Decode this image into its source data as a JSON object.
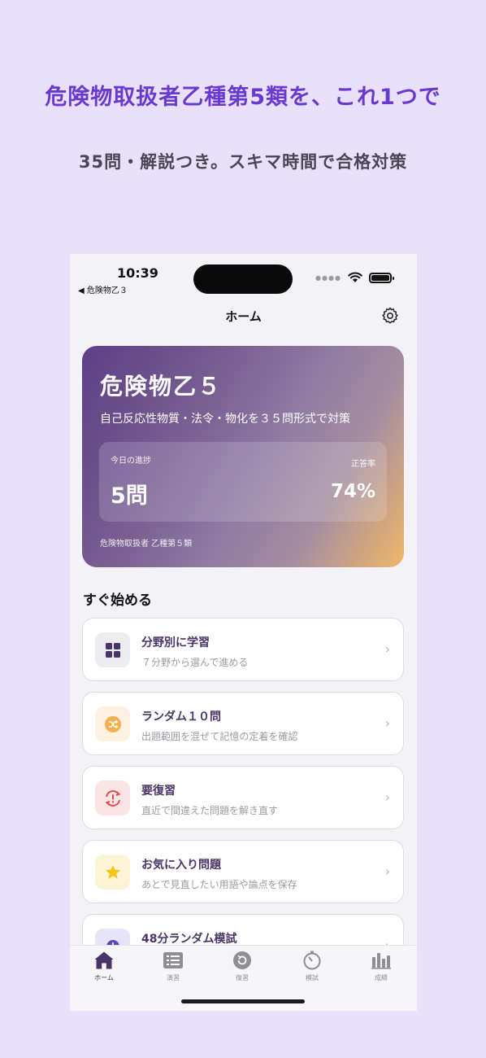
{
  "promo": {
    "title": "危険物取扱者乙種第5類を、これ1つで",
    "subtitle": "35問・解説つき。スキマ時間で合格対策"
  },
  "status_bar": {
    "time": "10:39",
    "back_label": "◀ 危険物乙３"
  },
  "nav": {
    "title": "ホーム"
  },
  "hero": {
    "title": "危険物乙５",
    "subtitle": "自己反応性物質・法令・物化を３５問形式で対策",
    "progress_label": "今日の進捗",
    "progress_value": "5問",
    "accuracy_label": "正答率",
    "accuracy_value": "74%",
    "footer": "危険物取扱者 乙種第５類"
  },
  "quick_start": {
    "section_title": "すぐ始める",
    "items": [
      {
        "title": "分野別に学習",
        "desc": "７分野から選んで進める",
        "icon": "grid-icon"
      },
      {
        "title": "ランダム１０問",
        "desc": "出題範囲を混ぜて記憶の定着を確認",
        "icon": "shuffle-icon"
      },
      {
        "title": "要復習",
        "desc": "直近で間違えた問題を解き直す",
        "icon": "review-alert-icon"
      },
      {
        "title": "お気に入り問題",
        "desc": "あとで見直したい用語や論点を保存",
        "icon": "star-icon"
      },
      {
        "title": "48分ランダム模試",
        "desc": "",
        "icon": "timer-icon"
      }
    ]
  },
  "tabbar": {
    "tabs": [
      {
        "label": "ホーム",
        "icon": "house-icon",
        "active": true
      },
      {
        "label": "演習",
        "icon": "list-icon",
        "active": false
      },
      {
        "label": "復習",
        "icon": "review-icon",
        "active": false
      },
      {
        "label": "模試",
        "icon": "stopwatch-icon",
        "active": false
      },
      {
        "label": "成績",
        "icon": "bar-chart-icon",
        "active": false
      }
    ]
  },
  "colors": {
    "accent": "#6a3ad0",
    "title_text": "#4a3467",
    "background": "#e9e0fb"
  }
}
